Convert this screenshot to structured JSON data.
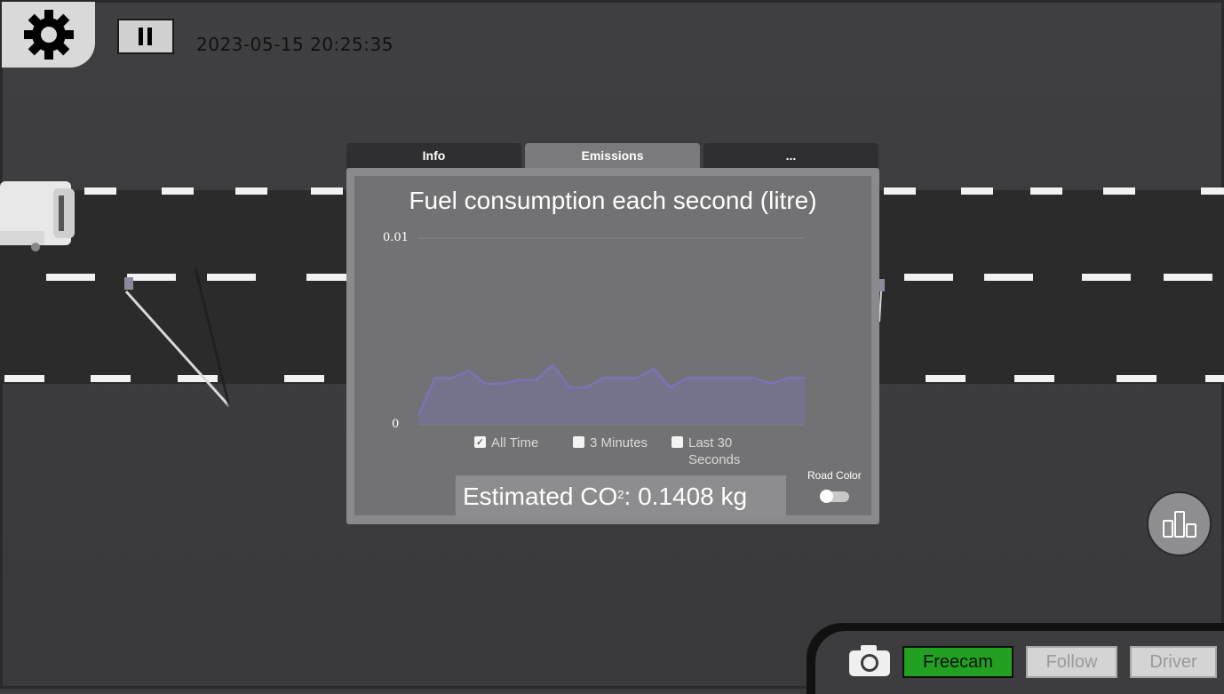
{
  "topbar": {
    "timestamp": "2023-05-15 20:25:35"
  },
  "tabs": [
    {
      "label": "Info",
      "active": false
    },
    {
      "label": "Emissions",
      "active": true
    },
    {
      "label": "...",
      "active": false
    }
  ],
  "chart": {
    "legend": {
      "all_time": "All Time",
      "three_minutes": "3 Minutes",
      "last_30_line1": "Last 30",
      "last_30_line2": "Seconds"
    }
  },
  "chart_data": {
    "type": "area",
    "title": "Fuel consumption each second (litre)",
    "xlabel": "",
    "ylabel": "",
    "ylim": [
      0,
      0.01
    ],
    "y_tick_labels": [
      "0.01",
      "0"
    ],
    "grid": true,
    "series": [
      {
        "color": "#7b73b8",
        "values": [
          0.0005,
          0.0025,
          0.0025,
          0.0029,
          0.0022,
          0.0022,
          0.0024,
          0.0024,
          0.0032,
          0.002,
          0.002,
          0.0025,
          0.0025,
          0.0025,
          0.003,
          0.002,
          0.0025,
          0.0025,
          0.0025,
          0.0025,
          0.0025,
          0.0022,
          0.0025,
          0.0025
        ]
      }
    ],
    "selected_range": "All Time"
  },
  "emissions": {
    "co2_prefix": "Estimated CO",
    "co2_sup": "2",
    "co2_value": ": 0.1408 kg"
  },
  "road_color": {
    "label": "Road Color",
    "enabled": false
  },
  "camera_modes": {
    "freecam": "Freecam",
    "follow": "Follow",
    "driver": "Driver",
    "active": "Freecam"
  },
  "colors": {
    "active_mode": "#22a022",
    "chart_line": "#7b73b8"
  }
}
